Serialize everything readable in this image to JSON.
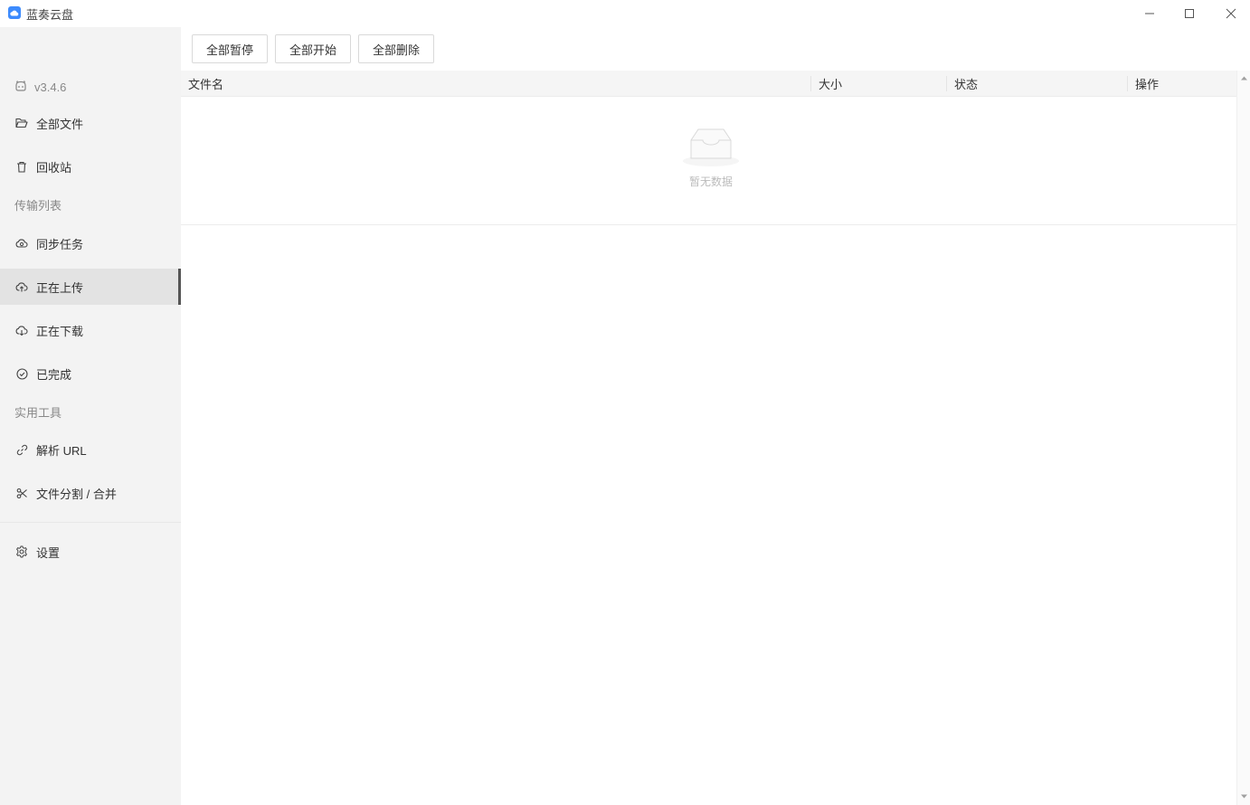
{
  "window": {
    "title": "蓝奏云盘",
    "controls": [
      "minimize",
      "maximize",
      "close"
    ]
  },
  "sidebar": {
    "version": "v3.4.6",
    "items_top": [
      {
        "label": "全部文件",
        "icon": "folder-open-icon"
      },
      {
        "label": "回收站",
        "icon": "trash-icon"
      }
    ],
    "section_transfer": "传输列表",
    "items_transfer": [
      {
        "label": "同步任务",
        "icon": "cloud-sync-icon"
      },
      {
        "label": "正在上传",
        "icon": "cloud-upload-icon",
        "active": true
      },
      {
        "label": "正在下载",
        "icon": "cloud-download-icon"
      },
      {
        "label": "已完成",
        "icon": "check-circle-icon"
      }
    ],
    "section_tools": "实用工具",
    "items_tools": [
      {
        "label": "解析 URL",
        "icon": "link-icon"
      },
      {
        "label": "文件分割 / 合并",
        "icon": "scissors-icon"
      }
    ],
    "items_bottom": [
      {
        "label": "设置",
        "icon": "gear-icon"
      }
    ]
  },
  "toolbar": {
    "pause_all": "全部暂停",
    "start_all": "全部开始",
    "delete_all": "全部删除"
  },
  "table": {
    "columns": [
      "文件名",
      "大小",
      "状态",
      "操作"
    ],
    "rows": [],
    "empty_text": "暂无数据"
  }
}
